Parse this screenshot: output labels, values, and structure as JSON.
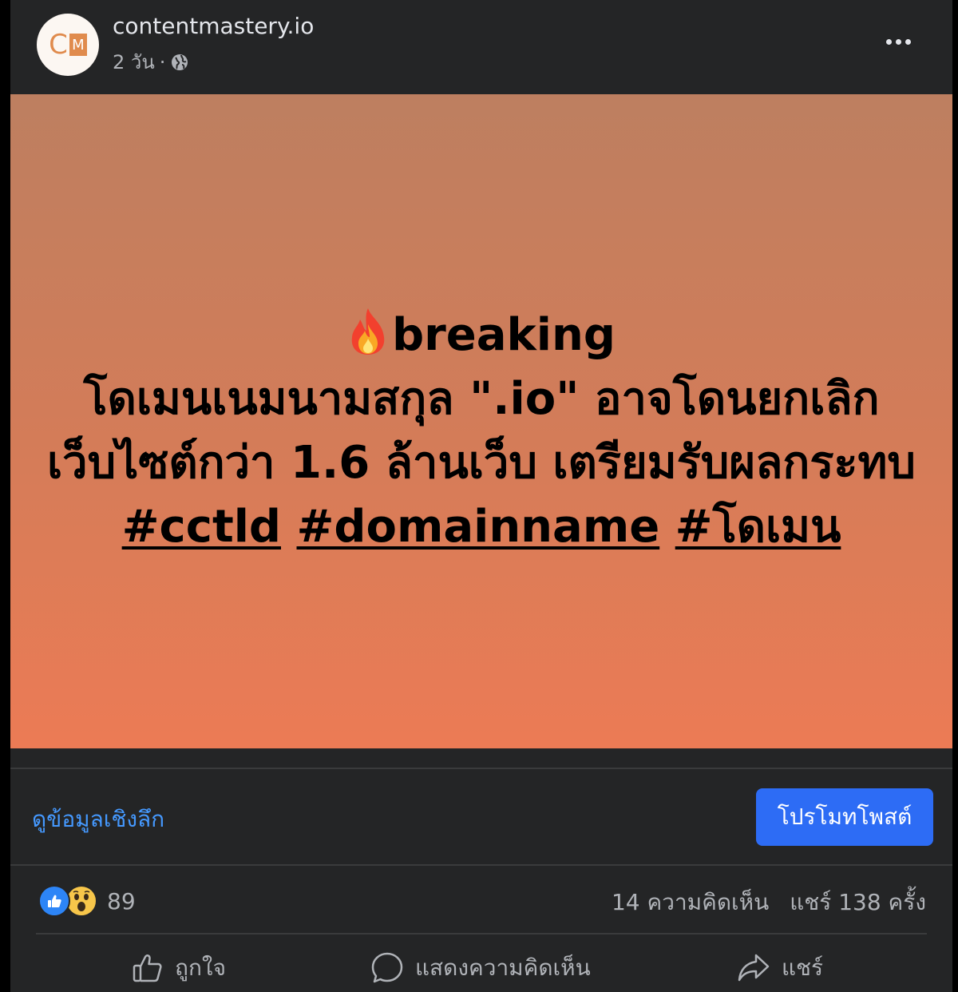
{
  "post": {
    "page_name": "contentmastery.io",
    "avatar_letters": [
      "C",
      "M"
    ],
    "time": "2 วัน",
    "separator": "·",
    "privacy_icon": "globe-icon",
    "more_icon": "more-horizontal-icon"
  },
  "image": {
    "icon": "fire-emoji",
    "line1": "breaking",
    "line2": "โดเมนเนมนามสกุล \".io\" อาจโดนยกเลิก",
    "line3": "เว็บไซต์กว่า 1.6 ล้านเว็บ เตรียมรับผลกระทบ",
    "hashtags": [
      "#cctld",
      "#domainname",
      "#โดเมน"
    ],
    "gradient_colors": [
      "#bd7f60",
      "#d57c58",
      "#ec7b55"
    ]
  },
  "insights": {
    "link_label": "ดูข้อมูลเชิงลึก",
    "promote_label": "โปรโมทโพสต์",
    "accent_color": "#2d6cf5"
  },
  "stats": {
    "reaction_icons": [
      "like-reaction-icon",
      "wow-reaction-icon"
    ],
    "reaction_count": "89",
    "comments": "14 ความคิดเห็น",
    "shares": "แชร์ 138 ครั้ง"
  },
  "actions": {
    "like_label": "ถูกใจ",
    "comment_label": "แสดงความคิดเห็น",
    "share_label": "แชร์"
  }
}
